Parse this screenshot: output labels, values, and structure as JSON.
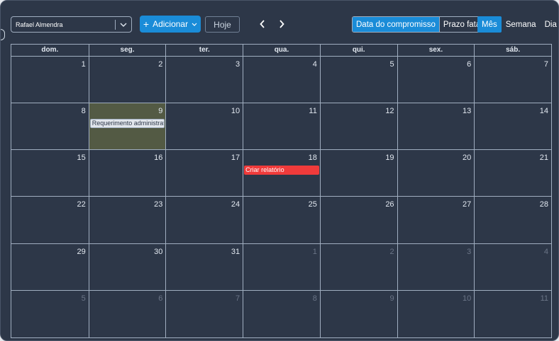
{
  "colors": {
    "background": "#2d3748",
    "accent": "#1a8cd8",
    "today": "#535a44",
    "event_red": "#f03b3b"
  },
  "toolbar": {
    "user_value": "Rafael Almendra",
    "add_label": "Adicionar",
    "today_label": "Hoje",
    "date_filter": [
      "Data do compromisso",
      "Prazo fatal"
    ],
    "views": [
      "Mês",
      "Semana",
      "Dia"
    ]
  },
  "calendar": {
    "weekdays": [
      "dom.",
      "seg.",
      "ter.",
      "qua.",
      "qui.",
      "sex.",
      "sáb."
    ],
    "weeks": [
      [
        {
          "d": "1"
        },
        {
          "d": "2"
        },
        {
          "d": "3"
        },
        {
          "d": "4"
        },
        {
          "d": "5"
        },
        {
          "d": "6"
        },
        {
          "d": "7"
        }
      ],
      [
        {
          "d": "8"
        },
        {
          "d": "9",
          "today": true,
          "event": {
            "title": "Requerimento administrativo",
            "style": "light"
          }
        },
        {
          "d": "10"
        },
        {
          "d": "11"
        },
        {
          "d": "12"
        },
        {
          "d": "13"
        },
        {
          "d": "14"
        }
      ],
      [
        {
          "d": "15"
        },
        {
          "d": "16"
        },
        {
          "d": "17"
        },
        {
          "d": "18",
          "event": {
            "title": "Criar relatório",
            "style": "red"
          }
        },
        {
          "d": "19"
        },
        {
          "d": "20"
        },
        {
          "d": "21"
        }
      ],
      [
        {
          "d": "22"
        },
        {
          "d": "23"
        },
        {
          "d": "24"
        },
        {
          "d": "25"
        },
        {
          "d": "26"
        },
        {
          "d": "27"
        },
        {
          "d": "28"
        }
      ],
      [
        {
          "d": "29"
        },
        {
          "d": "30"
        },
        {
          "d": "31"
        },
        {
          "d": "1",
          "off": true
        },
        {
          "d": "2",
          "off": true
        },
        {
          "d": "3",
          "off": true
        },
        {
          "d": "4",
          "off": true
        }
      ],
      [
        {
          "d": "5",
          "off": true
        },
        {
          "d": "6",
          "off": true
        },
        {
          "d": "7",
          "off": true
        },
        {
          "d": "8",
          "off": true
        },
        {
          "d": "9",
          "off": true
        },
        {
          "d": "10",
          "off": true
        },
        {
          "d": "11",
          "off": true
        }
      ]
    ]
  }
}
